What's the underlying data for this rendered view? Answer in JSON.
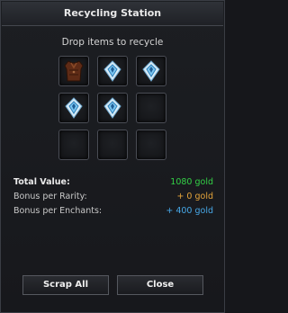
{
  "window": {
    "title": "Recycling Station"
  },
  "instructions": "Drop items to recycle",
  "slots": [
    {
      "item": "leather-armor-icon"
    },
    {
      "item": "blue-crystal-gem-icon"
    },
    {
      "item": "blue-crystal-gem-icon"
    },
    {
      "item": "blue-crystal-gem-icon"
    },
    {
      "item": "blue-crystal-gem-icon"
    },
    {
      "item": null
    },
    {
      "item": null
    },
    {
      "item": null
    },
    {
      "item": null
    }
  ],
  "stats": {
    "total_label": "Total Value:",
    "total_value": "1080 gold",
    "rarity_label": "Bonus per Rarity:",
    "rarity_value": "+ 0 gold",
    "enchants_label": "Bonus per Enchants:",
    "enchants_value": "+ 400 gold"
  },
  "buttons": {
    "scrap": "Scrap All",
    "close": "Close"
  },
  "colors": {
    "total": "#33d046",
    "rarity": "#e5a43a",
    "enchants": "#47a7e6",
    "crystal": "#7cc7f2"
  }
}
